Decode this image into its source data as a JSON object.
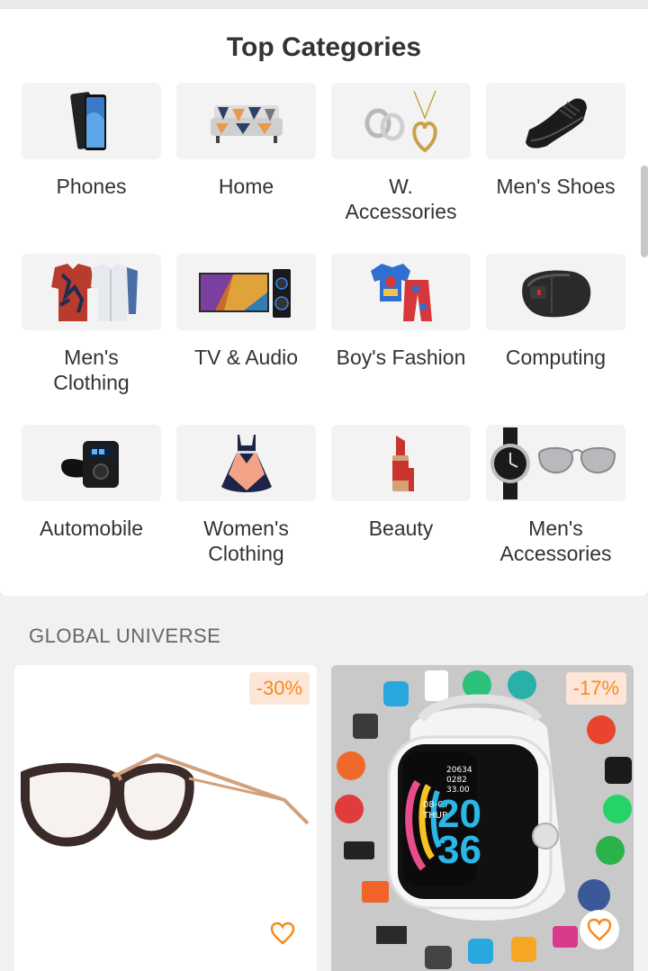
{
  "top_categories": {
    "title": "Top Categories",
    "items": [
      {
        "label": "Phones",
        "icon": "phone-icon"
      },
      {
        "label": "Home",
        "icon": "sofa-icon"
      },
      {
        "label": "W. Accessories",
        "icon": "rings-icon"
      },
      {
        "label": "Men's Shoes",
        "icon": "shoe-icon"
      },
      {
        "label": "Men's Clothing",
        "icon": "shirts-icon"
      },
      {
        "label": "TV & Audio",
        "icon": "tv-speaker-icon"
      },
      {
        "label": "Boy's Fashion",
        "icon": "pajamas-icon"
      },
      {
        "label": "Computing",
        "icon": "mouse-icon"
      },
      {
        "label": "Automobile",
        "icon": "car-charger-icon"
      },
      {
        "label": "Women's Clothing",
        "icon": "dress-icon"
      },
      {
        "label": "Beauty",
        "icon": "lipstick-icon"
      },
      {
        "label": "Men's Accessories",
        "icon": "watch-sunglasses-icon"
      }
    ]
  },
  "global_universe": {
    "title": "GLOBAL UNIVERSE",
    "products": [
      {
        "discount": "-30%",
        "image": "eyeglasses-icon"
      },
      {
        "discount": "-17%",
        "image": "smartwatch-icon",
        "watch_time": [
          "08-07",
          "THUR",
          "20",
          "36"
        ],
        "watch_stats": [
          "20634",
          "0282",
          "33.00"
        ]
      }
    ]
  },
  "colors": {
    "accent": "#f68b1e",
    "discount_bg": "#fde5d8",
    "page_bg": "#f1f1f1"
  }
}
